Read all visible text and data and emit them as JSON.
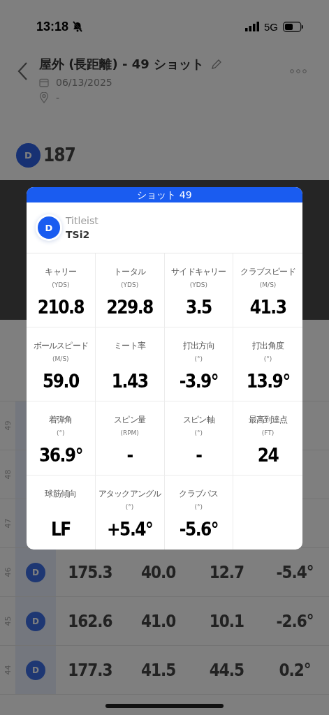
{
  "status_bar": {
    "time": "13:18",
    "network": "5G"
  },
  "header": {
    "title": "屋外 (長距離) - 49 ショット",
    "date": "06/13/2025",
    "location": "-"
  },
  "summary": {
    "badge": "D",
    "value": "187"
  },
  "shots": [
    {
      "number": "49"
    },
    {
      "number": "48"
    },
    {
      "number": "47"
    },
    {
      "number": "46",
      "badge": "D",
      "values": [
        "175.3",
        "40.0",
        "12.7",
        "-5.4°"
      ]
    },
    {
      "number": "45",
      "badge": "D",
      "values": [
        "162.6",
        "41.0",
        "10.1",
        "-2.6°"
      ]
    },
    {
      "number": "44",
      "badge": "D",
      "values": [
        "177.3",
        "41.5",
        "44.5",
        "0.2°"
      ]
    }
  ],
  "modal": {
    "title": "ショット 49",
    "club": {
      "badge": "D",
      "brand": "Titleist",
      "model": "TSi2"
    },
    "metrics": [
      {
        "label": "キャリー",
        "unit": "(YDS)",
        "value": "210.8"
      },
      {
        "label": "トータル",
        "unit": "(YDS)",
        "value": "229.8"
      },
      {
        "label": "サイドキャリー",
        "unit": "(YDS)",
        "value": "3.5"
      },
      {
        "label": "クラブスピード",
        "unit": "(M/S)",
        "value": "41.3"
      },
      {
        "label": "ボールスピード",
        "unit": "(M/S)",
        "value": "59.0"
      },
      {
        "label": "ミート率",
        "value": "1.43"
      },
      {
        "label": "打出方向",
        "unit": "(°)",
        "value": "-3.9°"
      },
      {
        "label": "打出角度",
        "unit": "(°)",
        "value": "13.9°"
      },
      {
        "label": "着弾角",
        "unit": "(°)",
        "value": "36.9°"
      },
      {
        "label": "スピン量",
        "unit": "(RPM)",
        "value": "-"
      },
      {
        "label": "スピン軸",
        "unit": "(°)",
        "value": "-"
      },
      {
        "label": "最高到達点",
        "unit": "(FT)",
        "value": "24"
      },
      {
        "label": "球筋傾向",
        "value": "LF"
      },
      {
        "label": "アタックアングル",
        "unit": "(°)",
        "value": "+5.4°"
      },
      {
        "label": "クラブパス",
        "unit": "(°)",
        "value": "-5.6°"
      }
    ]
  }
}
